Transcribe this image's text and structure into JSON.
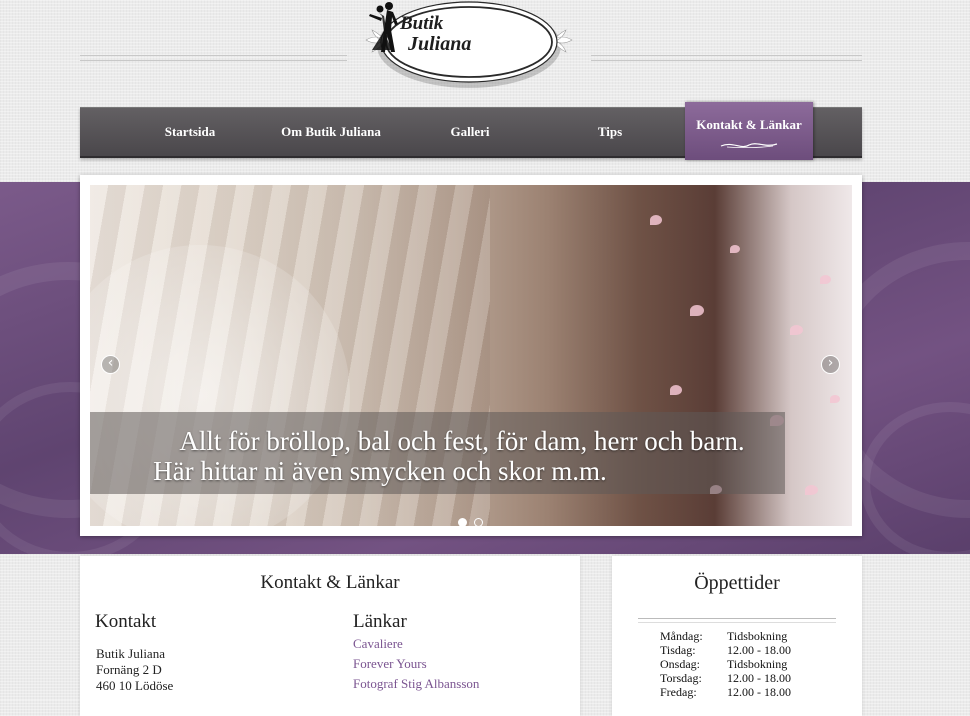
{
  "logo": {
    "line1": "Butik",
    "line2": "Juliana",
    "icon": "dancing-couple-icon"
  },
  "nav": {
    "items": [
      {
        "label": "Startsida"
      },
      {
        "label": "Om Butik Juliana"
      },
      {
        "label": "Galleri"
      },
      {
        "label": "Tips"
      },
      {
        "label": "Kontakt & Länkar",
        "active": true
      }
    ]
  },
  "slider": {
    "caption_line1": "Allt för bröllop, bal och fest, för dam, herr och barn.",
    "caption_line2": "Här hittar ni även smycken och skor m.m.",
    "prev_icon": "chevron-left-icon",
    "next_icon": "chevron-right-icon",
    "dots": 2,
    "active_dot": 1
  },
  "main": {
    "title": "Kontakt & Länkar",
    "contact": {
      "heading": "Kontakt",
      "lines": [
        "Butik Juliana",
        "Fornäng 2 D",
        "460 10 Lödöse"
      ]
    },
    "links": {
      "heading": "Länkar",
      "items": [
        "Cavaliere",
        "Forever Yours",
        "Fotograf Stig Albansson"
      ]
    }
  },
  "hours": {
    "title": "Öppettider",
    "rows": [
      {
        "day": "Måndag:",
        "time": "Tidsbokning"
      },
      {
        "day": "Tisdag:",
        "time": "12.00 - 18.00"
      },
      {
        "day": "Onsdag:",
        "time": "Tidsbokning"
      },
      {
        "day": "Torsdag:",
        "time": "12.00 - 18.00"
      },
      {
        "day": "Fredag:",
        "time": "12.00 - 18.00"
      }
    ]
  },
  "colors": {
    "accent": "#7b5591",
    "nav_bg": "#524f53",
    "band": "#6a4c7a"
  }
}
